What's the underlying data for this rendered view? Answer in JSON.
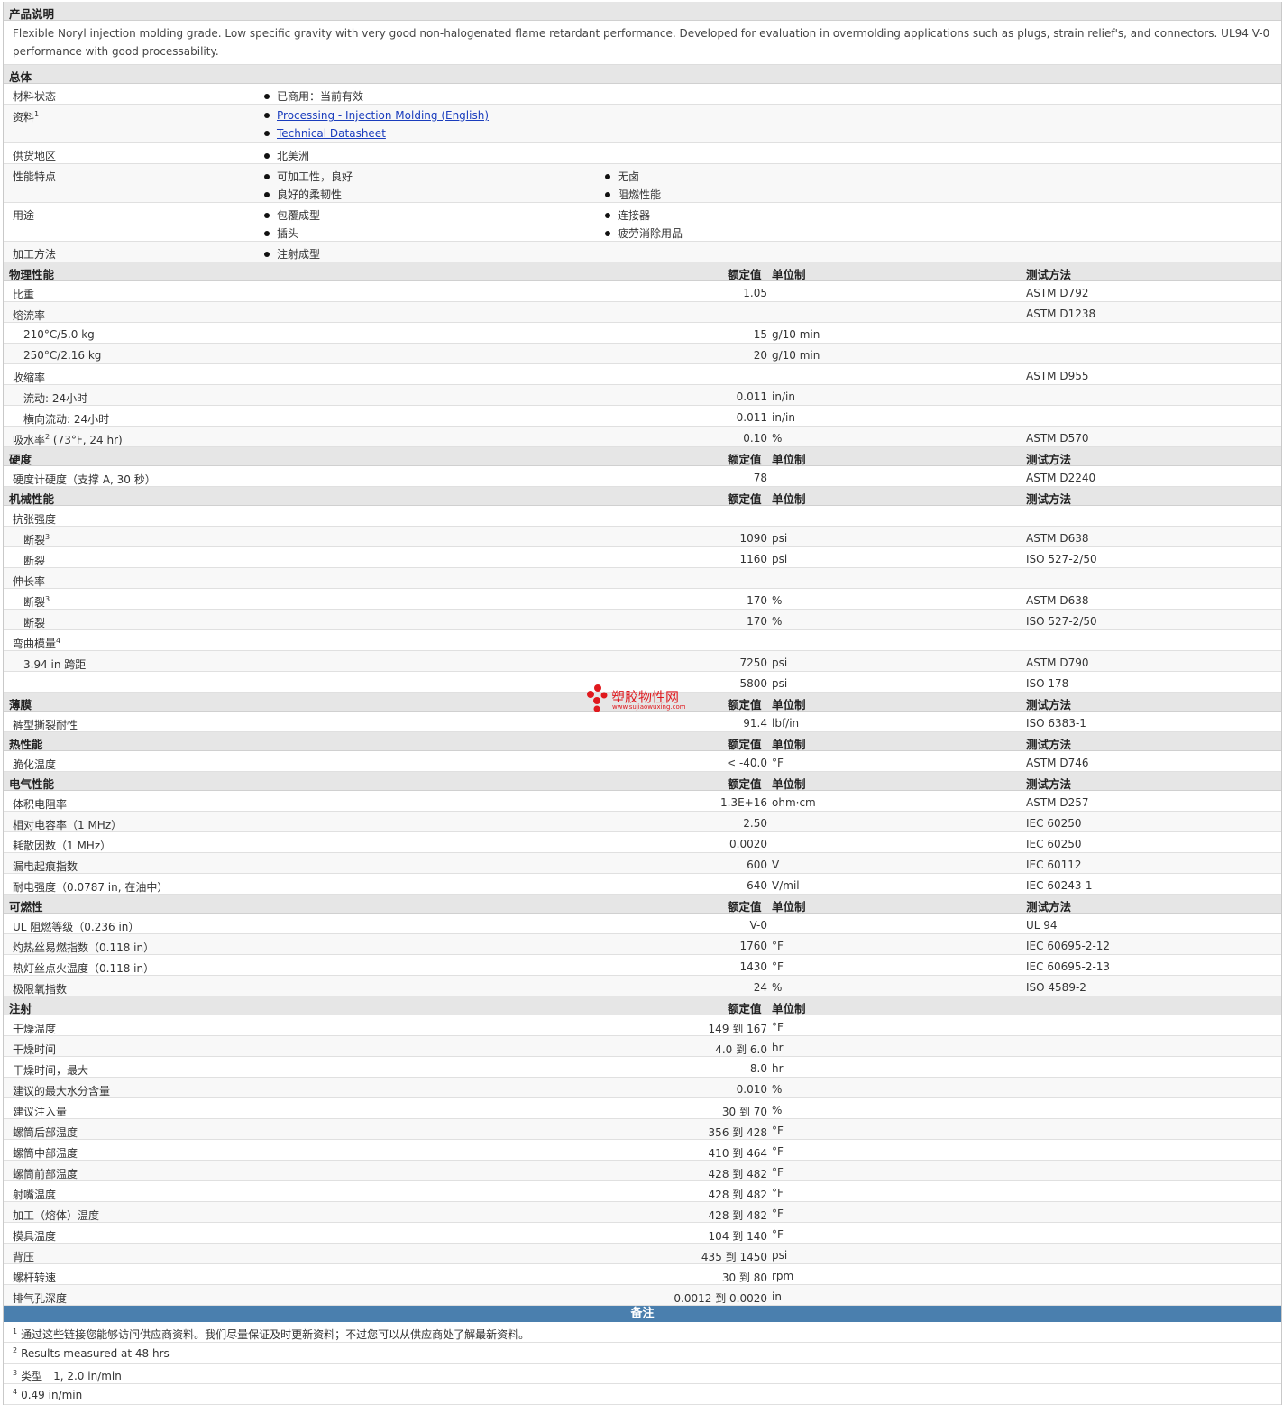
{
  "header_cols": {
    "value": "额定值",
    "unit": "单位制",
    "test": "测试方法"
  },
  "description": {
    "title": "产品说明",
    "text": "Flexible Noryl injection molding grade. Low specific gravity with very good non-halogenated flame retardant performance. Developed for evaluation in overmolding applications such as plugs, strain relief's, and connectors. UL94 V-0 performance with good processability."
  },
  "general": {
    "title": "总体",
    "rows": [
      {
        "label": "材料状态",
        "col1": [
          "已商用：当前有效"
        ],
        "col2": []
      },
      {
        "label": "资料",
        "sup": "1",
        "col1": [
          "Processing - Injection Molding (English)",
          "Technical Datasheet"
        ],
        "col2": [],
        "links": true
      },
      {
        "label": "供货地区",
        "col1": [
          "北美洲"
        ],
        "col2": []
      },
      {
        "label": "性能特点",
        "col1": [
          "可加工性，良好",
          "良好的柔韧性"
        ],
        "col2": [
          "无卤",
          "阻燃性能"
        ]
      },
      {
        "label": "用途",
        "col1": [
          "包覆成型",
          "插头"
        ],
        "col2": [
          "连接器",
          "疲劳消除用品"
        ]
      },
      {
        "label": "加工方法",
        "col1": [
          "注射成型"
        ],
        "col2": []
      }
    ]
  },
  "sections": [
    {
      "title": "物理性能",
      "rows": [
        {
          "label": "比重",
          "value": "1.05",
          "unit": "",
          "test": "ASTM D792"
        },
        {
          "label": "熔流率",
          "value": "",
          "unit": "",
          "test": "ASTM D1238"
        },
        {
          "label": "210°C/5.0 kg",
          "sub": true,
          "value": "15",
          "unit": "g/10 min",
          "test": ""
        },
        {
          "label": "250°C/2.16 kg",
          "sub": true,
          "value": "20",
          "unit": "g/10 min",
          "test": ""
        },
        {
          "label": "收缩率",
          "value": "",
          "unit": "",
          "test": "ASTM D955"
        },
        {
          "label": "流动: 24小时",
          "sub": true,
          "value": "0.011",
          "unit": "in/in",
          "test": ""
        },
        {
          "label": "横向流动: 24小时",
          "sub": true,
          "value": "0.011",
          "unit": "in/in",
          "test": ""
        },
        {
          "label": "吸水率",
          "sup": "2",
          "suffix": " (73°F, 24 hr)",
          "value": "0.10",
          "unit": "%",
          "test": "ASTM D570"
        }
      ]
    },
    {
      "title": "硬度",
      "rows": [
        {
          "label": "硬度计硬度（支撑 A, 30 秒）",
          "value": "78",
          "unit": "",
          "test": "ASTM D2240"
        }
      ]
    },
    {
      "title": "机械性能",
      "rows": [
        {
          "label": "抗张强度",
          "value": "",
          "unit": "",
          "test": ""
        },
        {
          "label": "断裂",
          "sub": true,
          "sup": "3",
          "value": "1090",
          "unit": "psi",
          "test": "ASTM D638"
        },
        {
          "label": "断裂",
          "sub": true,
          "value": "1160",
          "unit": "psi",
          "test": "ISO 527-2/50"
        },
        {
          "label": "伸长率",
          "value": "",
          "unit": "",
          "test": ""
        },
        {
          "label": "断裂",
          "sub": true,
          "sup": "3",
          "value": "170",
          "unit": "%",
          "test": "ASTM D638"
        },
        {
          "label": "断裂",
          "sub": true,
          "value": "170",
          "unit": "%",
          "test": "ISO 527-2/50"
        },
        {
          "label": "弯曲模量",
          "sup": "4",
          "value": "",
          "unit": "",
          "test": ""
        },
        {
          "label": "3.94 in 跨距",
          "sub": true,
          "value": "7250",
          "unit": "psi",
          "test": "ASTM D790"
        },
        {
          "label": "--",
          "sub": true,
          "value": "5800",
          "unit": "psi",
          "test": "ISO 178"
        }
      ]
    },
    {
      "title": "薄膜",
      "rows": [
        {
          "label": "裤型撕裂耐性",
          "value": "91.4",
          "unit": "lbf/in",
          "test": "ISO 6383-1"
        }
      ]
    },
    {
      "title": "热性能",
      "rows": [
        {
          "label": "脆化温度",
          "value": "< -40.0",
          "unit": "°F",
          "test": "ASTM D746"
        }
      ]
    },
    {
      "title": "电气性能",
      "rows": [
        {
          "label": "体积电阻率",
          "value": "1.3E+16",
          "unit": "ohm·cm",
          "test": "ASTM D257"
        },
        {
          "label": "相对电容率（1 MHz）",
          "value": "2.50",
          "unit": "",
          "test": "IEC 60250"
        },
        {
          "label": "耗散因数（1 MHz）",
          "value": "0.0020",
          "unit": "",
          "test": "IEC 60250"
        },
        {
          "label": "漏电起痕指数",
          "value": "600",
          "unit": "V",
          "test": "IEC 60112"
        },
        {
          "label": "耐电强度（0.0787 in, 在油中）",
          "value": "640",
          "unit": "V/mil",
          "test": "IEC 60243-1"
        }
      ]
    },
    {
      "title": "可燃性",
      "rows": [
        {
          "label": "UL 阻燃等级（0.236 in）",
          "value": "V-0",
          "unit": "",
          "test": "UL 94"
        },
        {
          "label": "灼热丝易燃指数（0.118 in）",
          "value": "1760",
          "unit": "°F",
          "test": "IEC 60695-2-12"
        },
        {
          "label": "热灯丝点火温度（0.118 in）",
          "value": "1430",
          "unit": "°F",
          "test": "IEC 60695-2-13"
        },
        {
          "label": "极限氧指数",
          "value": "24",
          "unit": "%",
          "test": "ISO 4589-2"
        }
      ]
    },
    {
      "title": "注射",
      "no_test": true,
      "rows": [
        {
          "label": "干燥温度",
          "value": "149 到 167",
          "unit": "°F",
          "test": ""
        },
        {
          "label": "干燥时间",
          "value": "4.0 到 6.0",
          "unit": "hr",
          "test": ""
        },
        {
          "label": "干燥时间，最大",
          "value": "8.0",
          "unit": "hr",
          "test": ""
        },
        {
          "label": "建议的最大水分含量",
          "value": "0.010",
          "unit": "%",
          "test": ""
        },
        {
          "label": "建议注入量",
          "value": "30 到 70",
          "unit": "%",
          "test": ""
        },
        {
          "label": "螺筒后部温度",
          "value": "356 到 428",
          "unit": "°F",
          "test": ""
        },
        {
          "label": "螺筒中部温度",
          "value": "410 到 464",
          "unit": "°F",
          "test": ""
        },
        {
          "label": "螺筒前部温度",
          "value": "428 到 482",
          "unit": "°F",
          "test": ""
        },
        {
          "label": "射嘴温度",
          "value": "428 到 482",
          "unit": "°F",
          "test": ""
        },
        {
          "label": "加工（熔体）温度",
          "value": "428 到 482",
          "unit": "°F",
          "test": ""
        },
        {
          "label": "模具温度",
          "value": "104 到 140",
          "unit": "°F",
          "test": ""
        },
        {
          "label": "背压",
          "value": "435 到 1450",
          "unit": "psi",
          "test": ""
        },
        {
          "label": "螺杆转速",
          "value": "30 到 80",
          "unit": "rpm",
          "test": ""
        },
        {
          "label": "排气孔深度",
          "value": "0.0012 到 0.0020",
          "unit": "in",
          "test": ""
        }
      ]
    }
  ],
  "notes": {
    "title": "备注",
    "items": [
      {
        "sup": "1",
        "text": "通过这些链接您能够访问供应商资料。我们尽量保证及时更新资料；不过您可以从供应商处了解最新资料。"
      },
      {
        "sup": "2",
        "text": "Results measured at 48 hrs"
      },
      {
        "sup": "3",
        "text": "类型　1, 2.0 in/min"
      },
      {
        "sup": "4",
        "text": "0.49 in/min"
      }
    ]
  },
  "watermark": {
    "title": "塑胶物性网",
    "url": "www.sujiaowuxing.com",
    "color": "#e0191e"
  }
}
